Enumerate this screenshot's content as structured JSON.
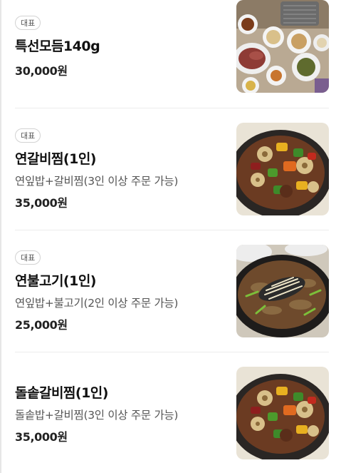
{
  "menu_items": [
    {
      "badge": "대표",
      "name": "특선모듬140g",
      "description": "",
      "price": "30,000원",
      "photo_icon": "table-spread-photo"
    },
    {
      "badge": "대표",
      "name": "연갈비찜(1인)",
      "description": "연잎밥+갈비찜(3인 이상 주문 가능)",
      "price": "35,000원",
      "photo_icon": "galbi-jjim-photo"
    },
    {
      "badge": "대표",
      "name": "연불고기(1인)",
      "description": "연잎밥+불고기(2인 이상 주문 가능)",
      "price": "25,000원",
      "photo_icon": "bulgogi-photo"
    },
    {
      "badge": "",
      "name": "돌솥갈비찜(1인)",
      "description": "돌솥밥+갈비찜(3인 이상 주문 가능)",
      "price": "35,000원",
      "photo_icon": "galbi-jjim-photo"
    }
  ],
  "colors": {
    "badge_border": "#d2d2d2",
    "divider": "#ececec",
    "text_primary": "#111111",
    "text_secondary": "#555555"
  }
}
